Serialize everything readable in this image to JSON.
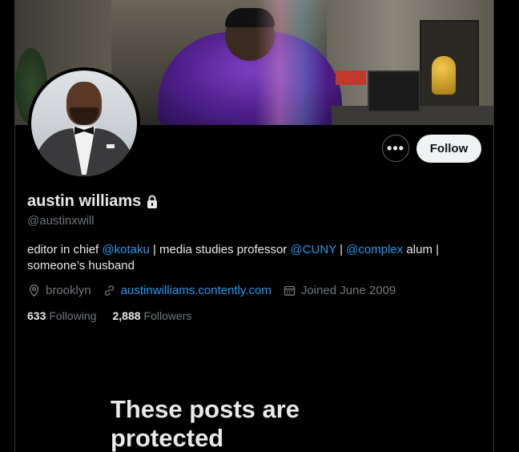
{
  "profile": {
    "display_name": "austin williams",
    "handle": "@austinxwill",
    "bio": {
      "p1": "editor in chief ",
      "m1": "@kotaku",
      "p2": " | media studies professor ",
      "m2": "@CUNY",
      "p3": " | ",
      "m3": "@complex",
      "p4": " alum | someone’s husband"
    },
    "location": "brooklyn",
    "website": "austinwilliams.contently.com",
    "joined": "Joined June 2009",
    "following_count": "633",
    "following_label": "Following",
    "followers_count": "2,888",
    "followers_label": "Followers"
  },
  "actions": {
    "more_label": "•••",
    "follow_label": "Follow"
  },
  "protected_notice": "These posts are protected",
  "icons": {
    "lock": "lock-icon",
    "location": "location-pin-icon",
    "link": "link-icon",
    "calendar": "calendar-icon",
    "more": "more-options-icon"
  },
  "colors": {
    "background": "#000000",
    "text_primary": "#e7e9ea",
    "text_secondary": "#71767b",
    "accent": "#1d9bf0",
    "follow_button_bg": "#eff3f4"
  }
}
